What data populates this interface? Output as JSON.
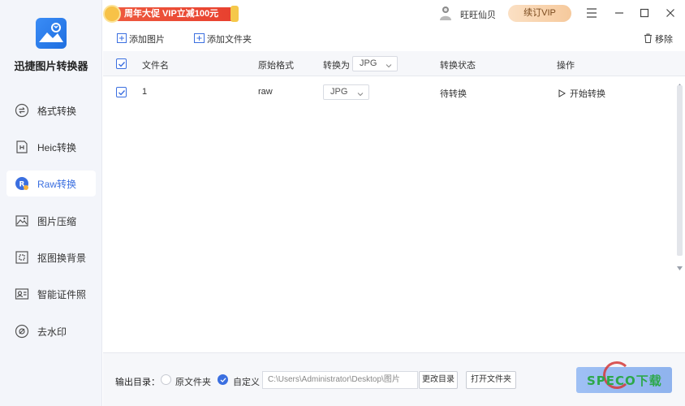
{
  "app": {
    "name": "迅捷图片转换器"
  },
  "sidebar": {
    "items": [
      {
        "label": "格式转换",
        "icon": "format-convert-icon"
      },
      {
        "label": "Heic转换",
        "icon": "heic-icon"
      },
      {
        "label": "Raw转换",
        "icon": "raw-icon",
        "active": true
      },
      {
        "label": "图片压缩",
        "icon": "image-compress-icon"
      },
      {
        "label": "抠图换背景",
        "icon": "cutout-icon"
      },
      {
        "label": "智能证件照",
        "icon": "id-photo-icon"
      },
      {
        "label": "去水印",
        "icon": "watermark-remove-icon"
      }
    ]
  },
  "titlebar": {
    "promo": "周年大促 VIP立减100元",
    "username": "旺旺仙贝",
    "vip_button": "续订VIP"
  },
  "toolbar": {
    "add_image": "添加图片",
    "add_folder": "添加文件夹",
    "remove": "移除"
  },
  "table": {
    "headers": {
      "filename": "文件名",
      "original_format": "原始格式",
      "convert_to": "转换为",
      "status": "转换状态",
      "action": "操作"
    },
    "header_format_select": "JPG",
    "rows": [
      {
        "filename": "1",
        "original_format": "raw",
        "target_format": "JPG",
        "status": "待转换",
        "action": "开始转换",
        "checked": true
      }
    ]
  },
  "footer": {
    "output_label": "输出目录：",
    "option_original": "原文件夹",
    "option_custom": "自定义",
    "path": "C:\\Users\\Administrator\\Desktop\\图片",
    "change_dir": "更改目录",
    "open_folder": "打开文件夹"
  },
  "watermark": {
    "text": "SPECO下载"
  },
  "colors": {
    "accent": "#3b6fe0",
    "promo": "#e8402e",
    "vip": "#f6c99c"
  }
}
